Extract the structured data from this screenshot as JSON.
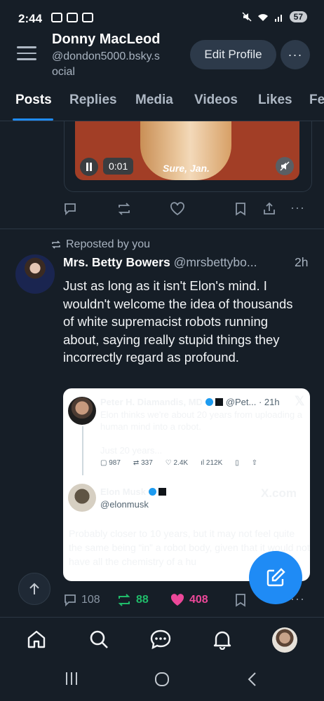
{
  "status_bar": {
    "time": "2:44",
    "battery": "57"
  },
  "profile_header": {
    "display_name": "Donny MacLeod",
    "handle": "@dondon5000.bsky.s ocial",
    "edit_profile_label": "Edit Profile",
    "more_label": "···"
  },
  "tabs": [
    "Posts",
    "Replies",
    "Media",
    "Videos",
    "Likes",
    "Fe"
  ],
  "previous_post": {
    "video_time": "0:01",
    "video_caption": "Sure, Jan."
  },
  "repost": {
    "label": "Reposted by you",
    "author_name": "Mrs. Betty Bowers",
    "author_handle": "@mrsbettybo...",
    "time": "2h",
    "text": "Just as long as it isn't Elon's mind. I wouldn't welcome the idea of thousands of white supremacist robots running about, saying really stupid things they incorrectly regard as profound.",
    "embed": {
      "tweet1_name": "Peter H. Diamandis, MD",
      "tweet1_handle_time": "@Pet... · 21h",
      "tweet1_text": "Elon thinks we're about 20 years from uploading a human mind into a robot.",
      "tweet1_text2": "Just 20 years...",
      "tweet1_metrics": [
        "987",
        "337",
        "2.4K",
        "212K"
      ],
      "tweet2_name": "Elon Musk",
      "tweet2_handle": "@elonmusk",
      "xcom": "X.com",
      "tweet2_text": "Probably closer to 10 years, but it may not feel quite the same being “in” a robot body, given that it would not have all the chemistry of a hu"
    },
    "stats": {
      "replies": "108",
      "reposts": "88",
      "likes": "408"
    }
  },
  "colors": {
    "background": "#161e27",
    "accent": "#1f8bf5",
    "repost_green": "#20bc6a",
    "like_pink": "#ec4899"
  }
}
